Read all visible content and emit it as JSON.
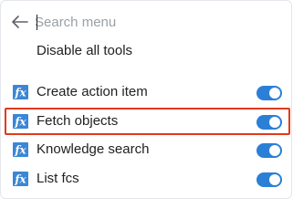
{
  "search": {
    "placeholder": "Search menu",
    "value": ""
  },
  "menu": {
    "disable_all_label": "Disable all tools"
  },
  "tools": [
    {
      "label": "Create action item",
      "enabled": true,
      "highlighted": false
    },
    {
      "label": "Fetch objects",
      "enabled": true,
      "highlighted": true
    },
    {
      "label": "Knowledge search",
      "enabled": true,
      "highlighted": false
    },
    {
      "label": "List fcs",
      "enabled": true,
      "highlighted": false
    }
  ],
  "icons": {
    "back": "arrow-left-icon",
    "tool": "fx-function-icon"
  },
  "colors": {
    "accent": "#2b7fd6",
    "icon_blue": "#3b86d6",
    "highlight_border": "#e03a1c",
    "text": "#202124",
    "placeholder": "#9aa0a6"
  }
}
